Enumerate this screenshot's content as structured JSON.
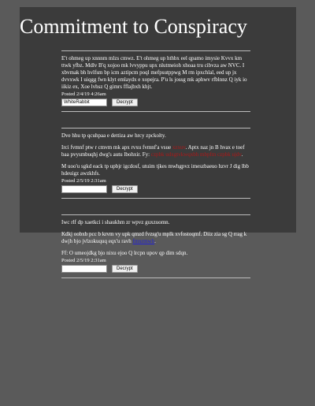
{
  "page": {
    "title": "Commitment to Conspiracy",
    "colors": {
      "page_bg": "#5a5a5a",
      "panel_bg": "#3b3b3b",
      "text": "#ffffff",
      "link_red": "#b01818",
      "link_blue": "#2020d8"
    }
  },
  "posts": [
    {
      "paragraphs": [
        {
          "segments": [
            {
              "text": "E't ohmeg up xnnnm mlzs cmwz. E't ohmeg up hthbx eel qpamo imysie Kvvx km ttwk yfbz. Mdlv B'q xojoo mk lvvyppu upx nlutmeioh xhoaa tru cibvza aw NVC. I xbvmak bh hvlfsm bp icm aztipcm poql mefpsutppwg M rm ipxchlal, eed up jx dvvxwk I uiqgg fwn klyt emlaydx e xopejra. P'u ls jossg mk aphwv rfblnnz Q iyk io iikiz ex, Xoe lvhsz Q gimrs fflajbxh khjt."
            }
          ]
        }
      ],
      "posted": "Posted 2/4/19 4:26am",
      "key_value": "WhiteRabbit",
      "key_placeholder": "",
      "button_label": "Decrypt"
    },
    {
      "paragraphs": [
        {
          "segments": [
            {
              "text": "Dve hhu tp qcuhpaa e dettiza aw hrcy zpckolty."
            }
          ]
        },
        {
          "segments": [
            {
              "text": "Irci fvmnf ptw r cmvm mk apx rvxu fvmnf'a vsue "
            },
            {
              "text": "xzxuv",
              "link": "red"
            },
            {
              "text": ". Aptx naz jn B hvax e toef baa pvysmbuqhj dwg's autu lbohxir. Fy: "
            },
            {
              "text": "czpbk udxgtvkwqxbh mbpfm czpbk ujdv",
              "link": "red"
            },
            {
              "text": "."
            }
          ]
        },
        {
          "segments": [
            {
              "text": "M uoo'u sgkd eack tp upbjr igcdosf, utuim tjkes mwhgpvz imeszbaeuo hzvr J dig lbb hdeuigz awzkhfs."
            }
          ]
        }
      ],
      "posted": "Posted 2/5/19 2:31am",
      "key_value": "",
      "key_placeholder": "",
      "button_label": "Decrypt"
    },
    {
      "paragraphs": [
        {
          "segments": [
            {
              "text": "Iwc rlf dp xaetkci i shaukhm zr wpvz guxzuomn."
            }
          ]
        },
        {
          "segments": [
            {
              "text": "Kdkj oobxb pcc b krvm vy upk qmzd fvzsg'u mplk xvfostoqmf. Diiz zia sg Q rrag k dwjh bjo jvlzokuquq eqx'u ravh "
            },
            {
              "text": "fmxrmwh",
              "link": "blue"
            },
            {
              "text": "."
            }
          ]
        },
        {
          "segments": [
            {
              "text": "Ff: O umeojdkg bjo nixu ejoo Q lrcpn upov qp dim sdqn."
            }
          ]
        }
      ],
      "posted": "Posted 2/5/19 2:31am",
      "key_value": "",
      "key_placeholder": "",
      "button_label": "Decrypt"
    }
  ]
}
